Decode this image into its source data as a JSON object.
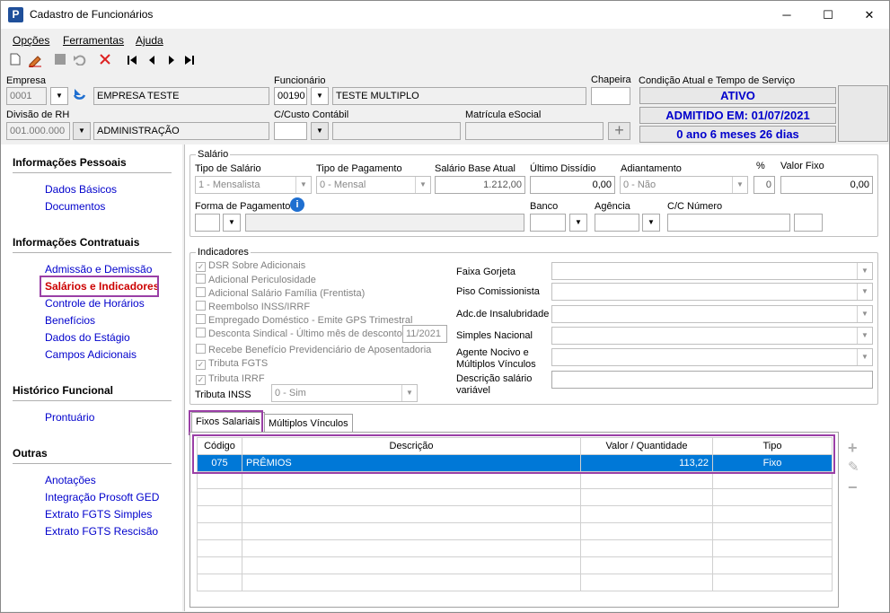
{
  "window": {
    "title": "Cadastro de Funcionários",
    "app_icon": "P",
    "min": "─",
    "max": "☐",
    "close": "✕"
  },
  "menu": [
    "Opções",
    "Ferramentas",
    "Ajuda"
  ],
  "header": {
    "empresa_label": "Empresa",
    "empresa_code": "0001",
    "empresa_name": "EMPRESA TESTE",
    "funcionario_label": "Funcionário",
    "funcionario_code": "00190",
    "funcionario_name": "TESTE MULTIPLO",
    "chapeira_label": "Chapeira",
    "chapeira_value": "",
    "condicao_label": "Condição Atual e Tempo de Serviço",
    "status_ativo": "ATIVO",
    "status_admitido": "ADMITIDO EM: 01/07/2021",
    "status_tempo": "0 ano 6 meses 26 dias",
    "divisao_label": "Divisão de RH",
    "divisao_code": "001.000.000",
    "divisao_name": "ADMINISTRAÇÃO",
    "ccusto_label": "C/Custo Contábil",
    "ccusto_value": "",
    "matricula_label": "Matrícula eSocial",
    "matricula_value": "",
    "add_btn": "+"
  },
  "sidebar": {
    "sections": [
      {
        "title": "Informações Pessoais",
        "items": [
          "Dados Básicos",
          "Documentos"
        ]
      },
      {
        "title": "Informações Contratuais",
        "items": [
          "Admissão e Demissão",
          "Salários e Indicadores",
          "Controle de Horários",
          "Benefícios",
          "Dados do Estágio",
          "Campos Adicionais"
        ]
      },
      {
        "title": "Histórico Funcional",
        "items": [
          "Prontuário"
        ]
      },
      {
        "title": "Outras",
        "items": [
          "Anotações",
          "Integração Prosoft GED",
          "Extrato FGTS Simples",
          "Extrato FGTS Rescisão"
        ]
      }
    ],
    "active_item": "Salários e Indicadores"
  },
  "salario": {
    "group_title": "Salário",
    "tipo_salario_label": "Tipo de Salário",
    "tipo_salario_value": "1 - Mensalista",
    "tipo_pagamento_label": "Tipo de Pagamento",
    "tipo_pagamento_value": "0 - Mensal",
    "salario_base_label": "Salário Base Atual",
    "salario_base_value": "1.212,00",
    "ultimo_dissidio_label": "Último Dissídio",
    "ultimo_dissidio_value": "0,00",
    "adiantamento_label": "Adiantamento",
    "adiantamento_value": "0 - Não",
    "pct_label": "%",
    "pct_value": "0",
    "valor_fixo_label": "Valor Fixo",
    "valor_fixo_value": "0,00",
    "forma_pagamento_label": "Forma de Pagamento",
    "forma_pagamento_value": "",
    "banco_label": "Banco",
    "agencia_label": "Agência",
    "cc_numero_label": "C/C Número",
    "info_icon": "i"
  },
  "indicadores": {
    "group_title": "Indicadores",
    "checkboxes": [
      {
        "label": "DSR Sobre Adicionais",
        "checked": true
      },
      {
        "label": "Adicional Periculosidade",
        "checked": false
      },
      {
        "label": "Adicional Salário Família (Frentista)",
        "checked": false
      },
      {
        "label": "Reembolso INSS/IRRF",
        "checked": false
      },
      {
        "label": "Empregado Doméstico - Emite GPS Trimestral",
        "checked": false
      },
      {
        "label": "Desconta Sindical - Último mês de desconto",
        "checked": false
      },
      {
        "label": "Recebe Benefício Previdenciário de Aposentadoria",
        "checked": false
      },
      {
        "label": "Tributa FGTS",
        "checked": true
      },
      {
        "label": "Tributa IRRF",
        "checked": true
      }
    ],
    "sindical_date": "11/2021",
    "tributa_inss_label": "Tributa INSS",
    "tributa_inss_value": "0 - Sim",
    "right_fields": [
      "Faixa Gorjeta",
      "Piso Comissionista",
      "Adc.de Insalubridade",
      "Simples Nacional",
      "Agente Nocivo e Múltiplos Vínculos",
      "Descrição salário variável"
    ]
  },
  "tabs": [
    "Fixos Salariais",
    "Múltiplos Vínculos"
  ],
  "grid": {
    "columns": [
      "Código",
      "Descrição",
      "Valor / Quantidade",
      "Tipo"
    ],
    "rows": [
      {
        "codigo": "075",
        "descricao": "PRÊMIOS",
        "valor": "113,22",
        "tipo": "Fixo"
      }
    ],
    "selected_color": "#0078d7"
  },
  "grid_actions": {
    "add": "+",
    "edit": "✎",
    "remove": "−"
  },
  "colors": {
    "link": "#0000cc",
    "highlight": "#9a3fa6",
    "status_text": "#0000cc"
  }
}
